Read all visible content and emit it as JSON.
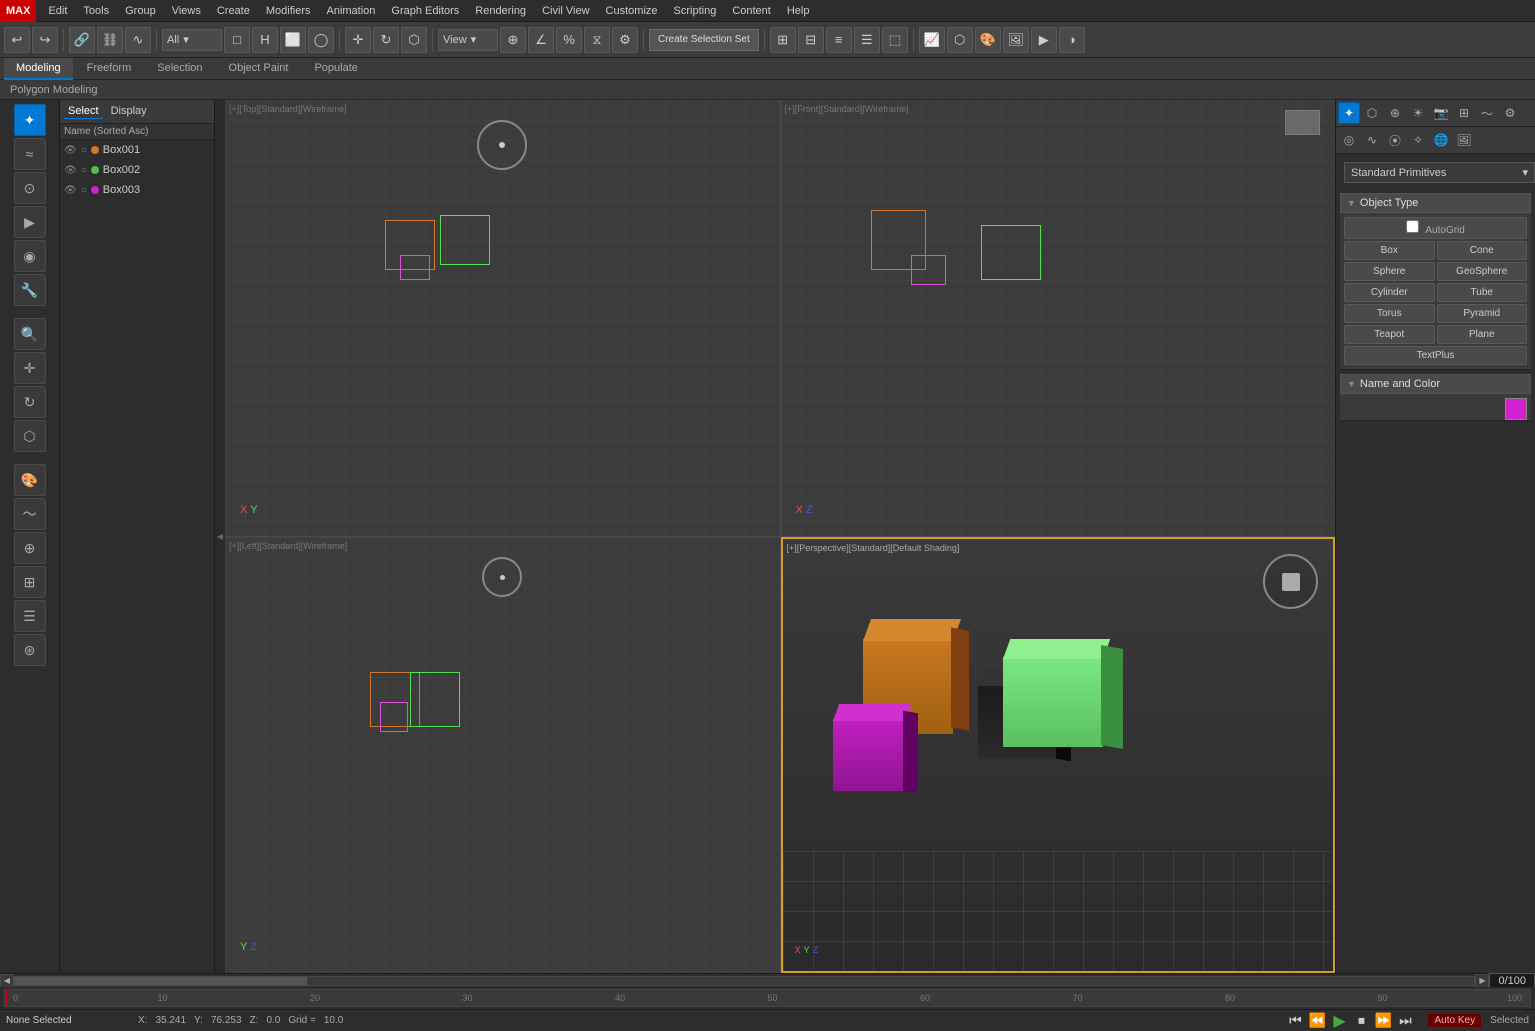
{
  "app": {
    "title": "MAX",
    "logo": "MAX"
  },
  "menu": {
    "items": [
      "Edit",
      "Tools",
      "Group",
      "Views",
      "Create",
      "Modifiers",
      "Animation",
      "Graph Editors",
      "Rendering",
      "Civil View",
      "Customize",
      "Scripting",
      "Content",
      "Help"
    ]
  },
  "toolbar": {
    "mode_dropdown": "All",
    "create_selection_btn": "Create Selection Set",
    "view_dropdown": "View"
  },
  "ribbon": {
    "tabs": [
      "Modeling",
      "Freeform",
      "Selection",
      "Object Paint",
      "Populate"
    ],
    "active_tab": "Modeling",
    "sub_label": "Polygon Modeling"
  },
  "scene_explorer": {
    "tabs": [
      "Select",
      "Display"
    ],
    "active_tab": "Select",
    "column_header": "Name (Sorted Asc)",
    "items": [
      {
        "name": "Box001",
        "dot_color": "#d4772a"
      },
      {
        "name": "Box002",
        "dot_color": "#50c050"
      },
      {
        "name": "Box003",
        "dot_color": "#d020d0"
      }
    ]
  },
  "viewports": {
    "top_left": {
      "label": "[+][Top][Standard][Wireframe]"
    },
    "top_right": {
      "label": "[+][Front][Standard][Wireframe]"
    },
    "bottom_left": {
      "label": "[+][Left][Standard][Wireframe]"
    },
    "bottom_right": {
      "label": "[+][Perspective][Standard][Default Shading]",
      "active": true
    }
  },
  "right_panel": {
    "primitive_dropdown": "Standard Primitives",
    "object_type_label": "Object Type",
    "autogrid_label": "AutoGrid",
    "buttons": [
      "Box",
      "Cone",
      "Sphere",
      "GeoSphere",
      "Cylinder",
      "Tube",
      "Torus",
      "Pyramid",
      "Teapot",
      "Plane",
      "TextPlus"
    ],
    "name_color_label": "Name and Color",
    "color": "#d020d0"
  },
  "status_bar": {
    "none_selected": "None Selected",
    "x_label": "X:",
    "x_val": "35.241",
    "y_label": "Y:",
    "y_val": "76.253",
    "z_label": "Z:",
    "z_val": "0.0",
    "grid_label": "Grid =",
    "grid_val": "10.0",
    "autokey_label": "Auto Key",
    "selected_label": "Selected"
  },
  "timeline": {
    "frame_current": "0",
    "frame_total": "100"
  }
}
